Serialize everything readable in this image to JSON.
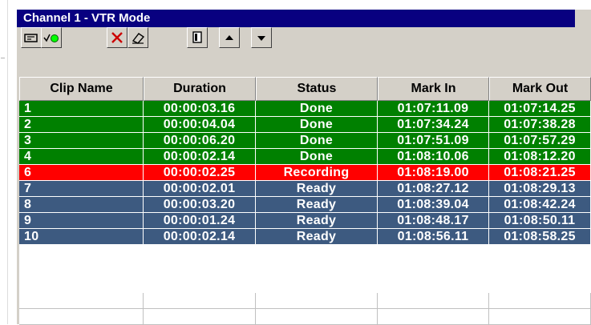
{
  "window": {
    "title": "Channel 1 - VTR Mode",
    "close_glyph": "×"
  },
  "toolbar": {
    "buttons": [
      {
        "name": "vtr-control-icon"
      },
      {
        "name": "check-on-air-icon"
      },
      {
        "name": "delete-icon"
      },
      {
        "name": "eraser-icon"
      },
      {
        "name": "copy-page-icon"
      },
      {
        "name": "move-up-icon"
      },
      {
        "name": "move-down-icon"
      }
    ]
  },
  "grid": {
    "columns": [
      "Clip Name",
      "Duration",
      "Status",
      "Mark In",
      "Mark Out"
    ],
    "rows": [
      {
        "clip": "1",
        "duration": "00:00:03.16",
        "status": "Done",
        "mark_in": "01:07:11.09",
        "mark_out": "01:07:14.25",
        "color": "#008000"
      },
      {
        "clip": "2",
        "duration": "00:00:04.04",
        "status": "Done",
        "mark_in": "01:07:34.24",
        "mark_out": "01:07:38.28",
        "color": "#008000"
      },
      {
        "clip": "3",
        "duration": "00:00:06.20",
        "status": "Done",
        "mark_in": "01:07:51.09",
        "mark_out": "01:07:57.29",
        "color": "#008000"
      },
      {
        "clip": "4",
        "duration": "00:00:02.14",
        "status": "Done",
        "mark_in": "01:08:10.06",
        "mark_out": "01:08:12.20",
        "color": "#008000"
      },
      {
        "clip": "6",
        "duration": "00:00:02.25",
        "status": "Recording",
        "mark_in": "01:08:19.00",
        "mark_out": "01:08:21.25",
        "color": "#ff0000"
      },
      {
        "clip": "7",
        "duration": "00:00:02.01",
        "status": "Ready",
        "mark_in": "01:08:27.12",
        "mark_out": "01:08:29.13",
        "color": "#3d5a80"
      },
      {
        "clip": "8",
        "duration": "00:00:03.20",
        "status": "Ready",
        "mark_in": "01:08:39.04",
        "mark_out": "01:08:42.24",
        "color": "#3d5a80"
      },
      {
        "clip": "9",
        "duration": "00:00:01.24",
        "status": "Ready",
        "mark_in": "01:08:48.17",
        "mark_out": "01:08:50.11",
        "color": "#3d5a80"
      },
      {
        "clip": "10",
        "duration": "00:00:02.14",
        "status": "Ready",
        "mark_in": "01:08:56.11",
        "mark_out": "01:08:58.25",
        "color": "#3d5a80"
      }
    ]
  },
  "colors": {
    "title_bar": "#080080",
    "done": "#008000",
    "recording": "#ff0000",
    "ready": "#3d5a80"
  }
}
